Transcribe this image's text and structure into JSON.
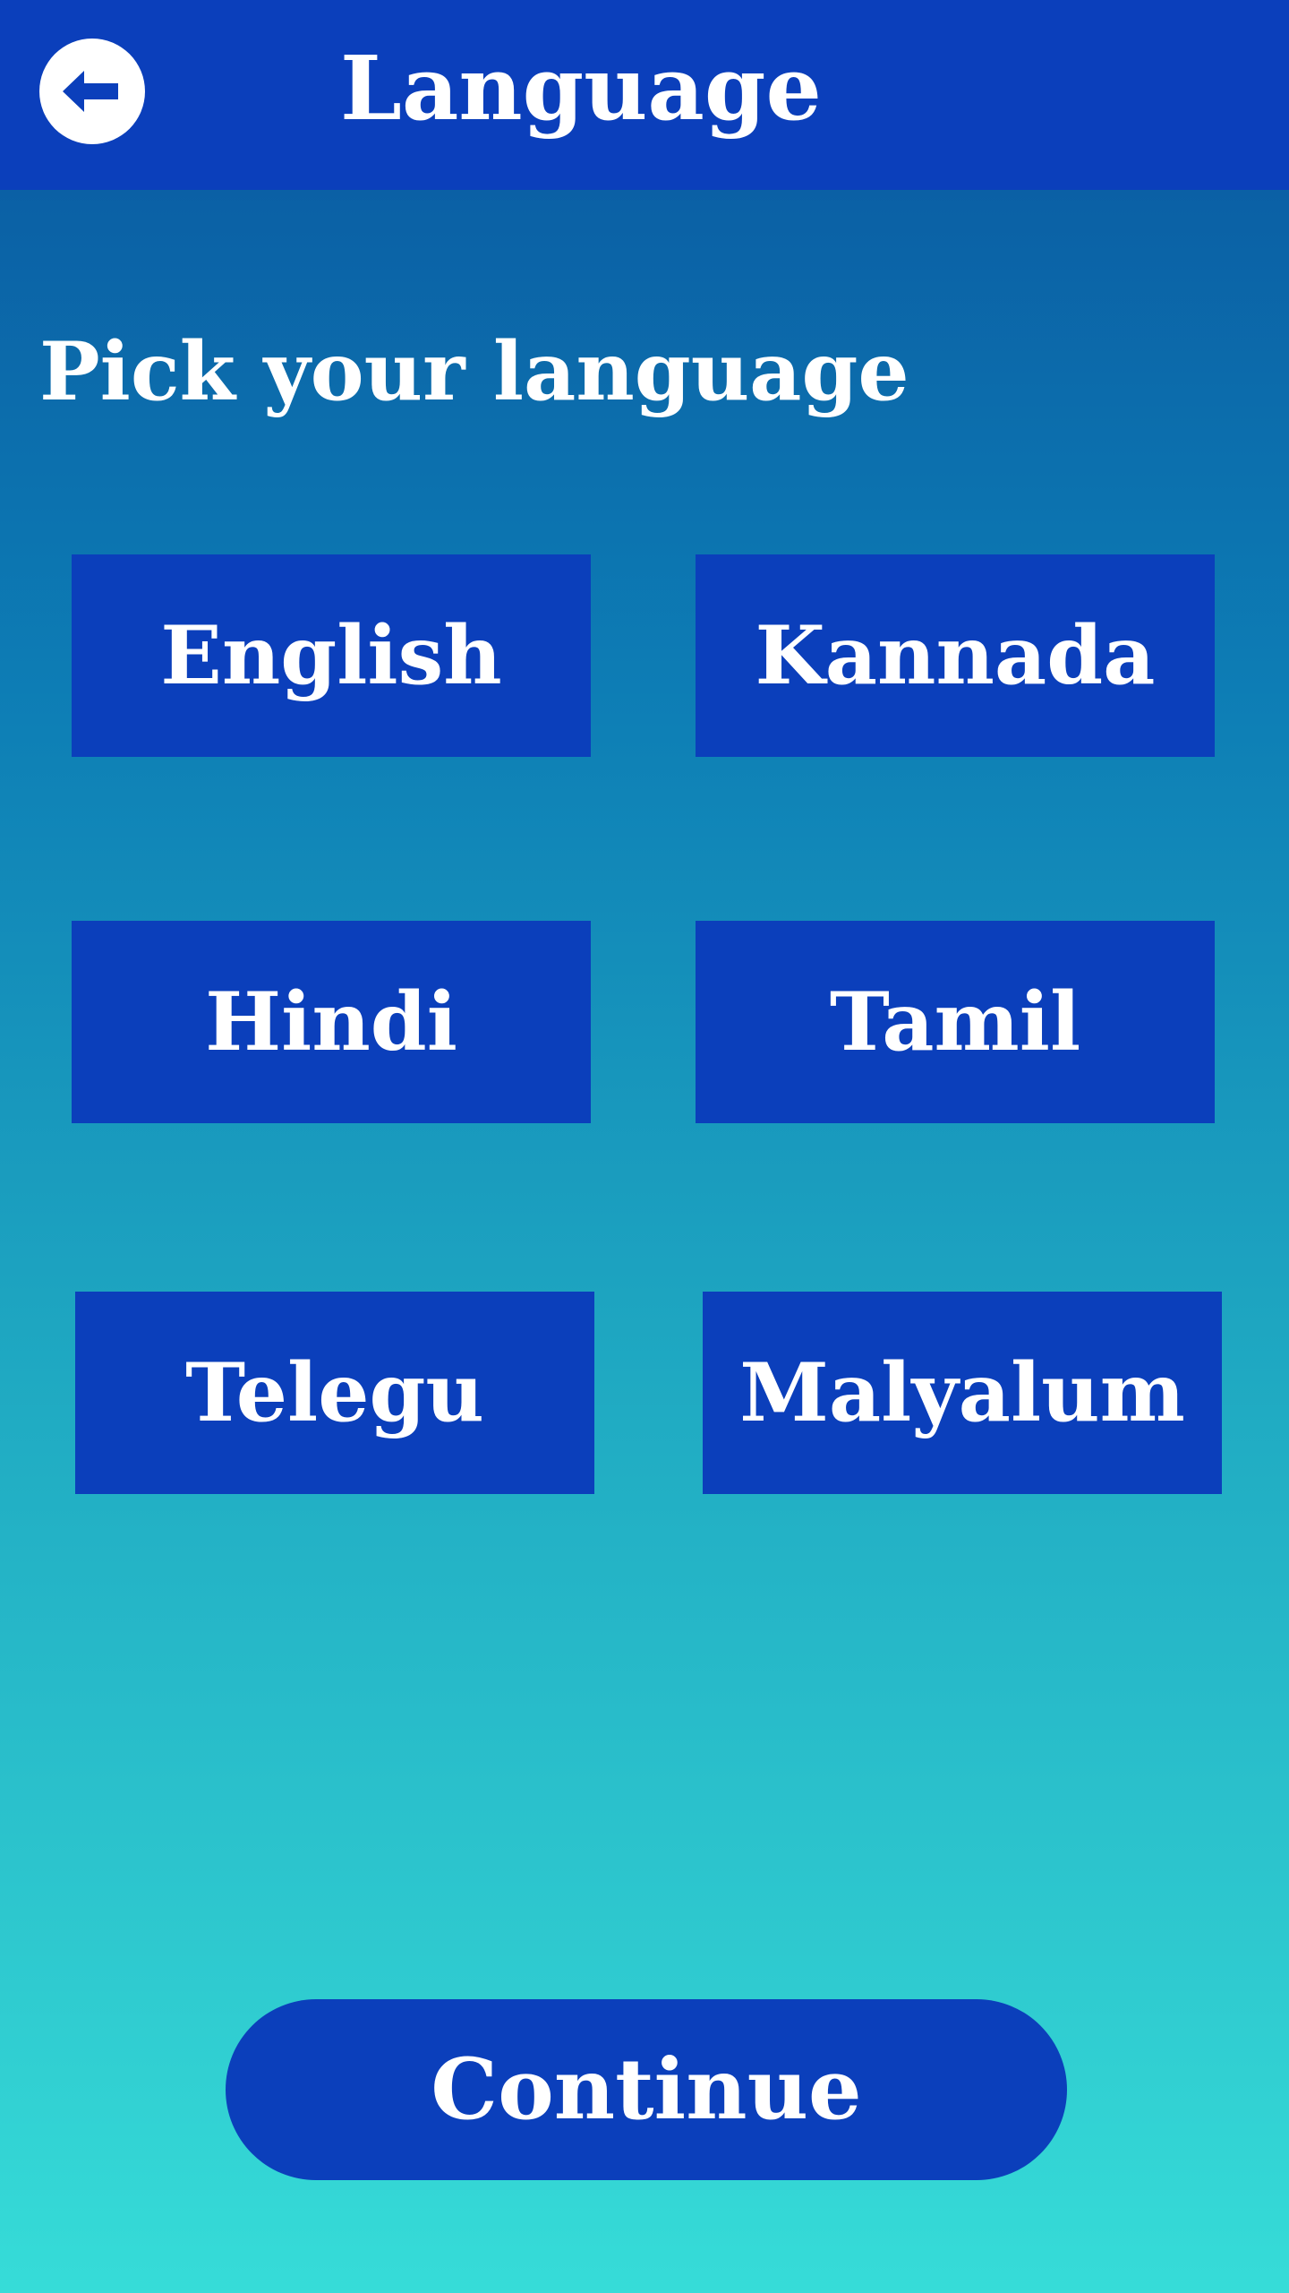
{
  "header": {
    "title": "Language",
    "back_icon": "arrow-left-icon"
  },
  "main": {
    "heading": "Pick your language",
    "languages": [
      {
        "label": "English"
      },
      {
        "label": "Kannada"
      },
      {
        "label": "Hindi"
      },
      {
        "label": "Tamil"
      },
      {
        "label": "Telegu"
      },
      {
        "label": "Malyalum"
      }
    ]
  },
  "footer": {
    "continue_label": "Continue"
  },
  "colors": {
    "primary": "#0b3fbb",
    "gradient_top": "#0a559f",
    "gradient_bottom": "#36dcd8",
    "text": "#ffffff"
  }
}
